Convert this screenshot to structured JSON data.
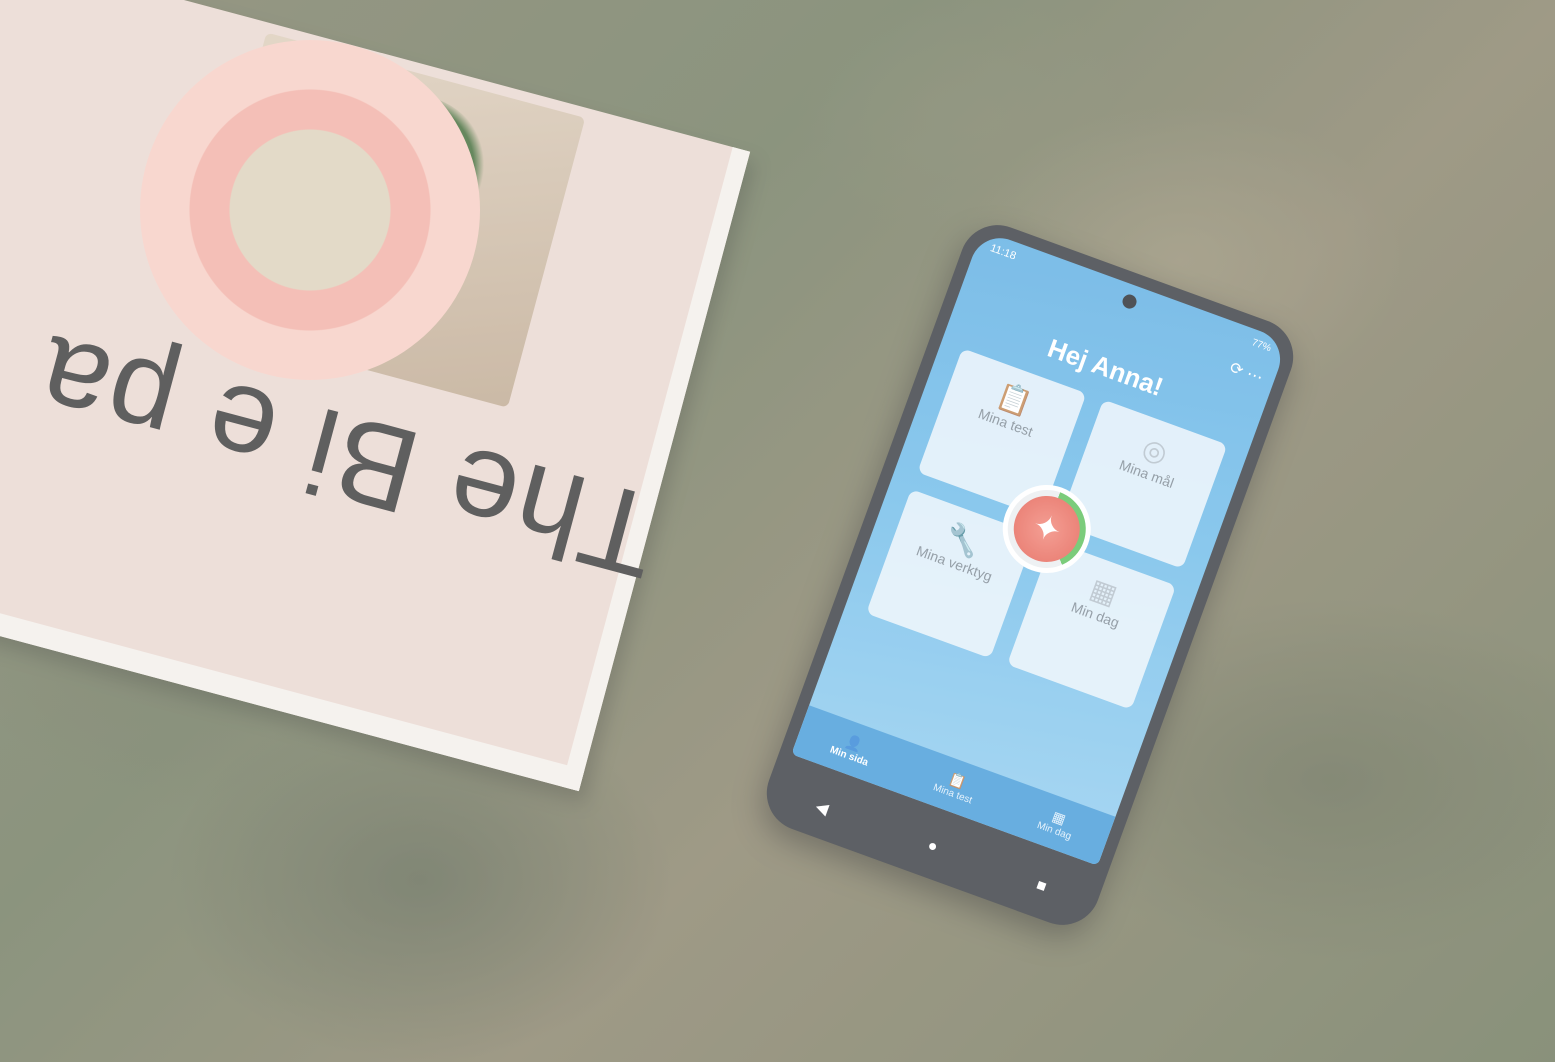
{
  "book": {
    "title_fragment": "The Bi e pa "
  },
  "phone": {
    "status_time": "11:18",
    "status_battery": "77%",
    "greeting": "Hej Anna!",
    "tiles": [
      {
        "label": "Mina test",
        "icon": "clipboard-icon"
      },
      {
        "label": "Mina mål",
        "icon": "target-icon"
      },
      {
        "label": "Mina verktyg",
        "icon": "wrench-icon"
      },
      {
        "label": "Min dag",
        "icon": "calendar-icon"
      }
    ],
    "bottom_nav": [
      {
        "label": "Min sida",
        "icon": "person-icon",
        "active": true
      },
      {
        "label": "Mina test",
        "icon": "clipboard-icon",
        "active": false
      },
      {
        "label": "Min dag",
        "icon": "calendar-icon",
        "active": false
      }
    ],
    "system_nav": [
      "back-icon",
      "home-icon",
      "recents-icon"
    ]
  }
}
